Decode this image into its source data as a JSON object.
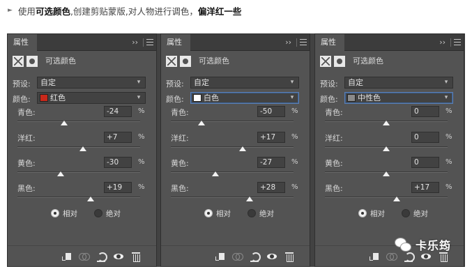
{
  "heading": {
    "bullet": "►",
    "part1": "使用",
    "bold1": "可选颜色",
    "part2": ",创建剪贴蒙版,对人物进行调色，",
    "bold2": "偏洋红一些"
  },
  "panels": [
    {
      "tab": "属性",
      "menu": "››",
      "title": "可选颜色",
      "preset_label": "预设:",
      "preset_value": "自定",
      "color_label": "颜色:",
      "color_value": "红色",
      "swatch": "#c8281a",
      "sliders": [
        {
          "label": "青色:",
          "value": "-24",
          "unit": "%",
          "level": -24
        },
        {
          "label": "洋红:",
          "value": "+7",
          "unit": "%",
          "level": 7
        },
        {
          "label": "黄色:",
          "value": "-30",
          "unit": "%",
          "level": -30
        },
        {
          "label": "黑色:",
          "value": "+19",
          "unit": "%",
          "level": 19
        }
      ],
      "relative": "相对",
      "absolute": "绝对",
      "mode": "relative"
    },
    {
      "tab": "属性",
      "menu": "››",
      "title": "可选颜色",
      "preset_label": "预设:",
      "preset_value": "自定",
      "color_label": "颜色:",
      "color_value": "白色",
      "swatch": "#ffffff",
      "sliders": [
        {
          "label": "青色:",
          "value": "-50",
          "unit": "%",
          "level": -50
        },
        {
          "label": "洋红:",
          "value": "+17",
          "unit": "%",
          "level": 17
        },
        {
          "label": "黄色:",
          "value": "-27",
          "unit": "%",
          "level": -27
        },
        {
          "label": "黑色:",
          "value": "+28",
          "unit": "%",
          "level": 28
        }
      ],
      "relative": "相对",
      "absolute": "绝对",
      "mode": "relative"
    },
    {
      "tab": "属性",
      "menu": "››",
      "title": "可选颜色",
      "preset_label": "预设:",
      "preset_value": "自定",
      "color_label": "颜色:",
      "color_value": "中性色",
      "swatch": "#8a8a8a",
      "sliders": [
        {
          "label": "青色:",
          "value": "0",
          "unit": "%",
          "level": 0
        },
        {
          "label": "洋红:",
          "value": "0",
          "unit": "%",
          "level": 0
        },
        {
          "label": "黄色:",
          "value": "0",
          "unit": "%",
          "level": 0
        },
        {
          "label": "黑色:",
          "value": "+17",
          "unit": "%",
          "level": 17
        }
      ],
      "relative": "相对",
      "absolute": "绝对",
      "mode": "relative"
    }
  ],
  "watermark": "卡乐筠"
}
